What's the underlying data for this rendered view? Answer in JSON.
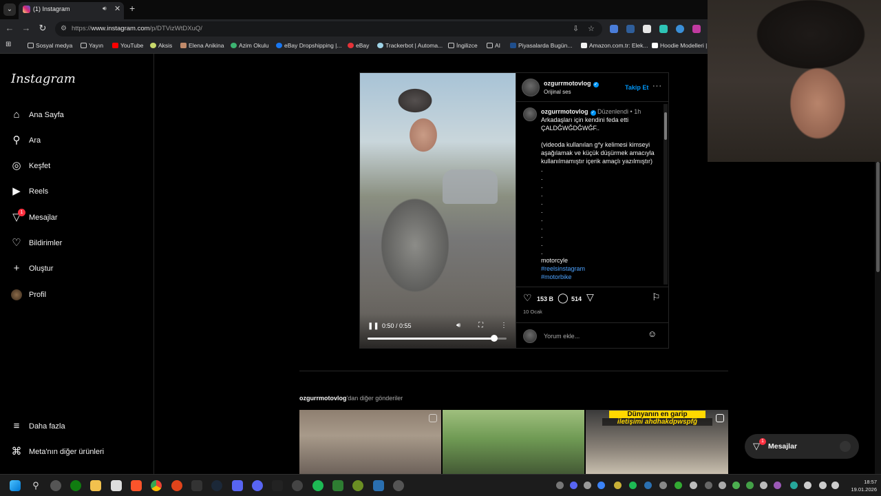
{
  "browser": {
    "tab_title": "(1) Instagram",
    "url_prefix": "https://",
    "url_domain": "www.instagram.com",
    "url_path": "/p/DTVizWtDXuQ/",
    "bookmarks": [
      "Sosyal medya",
      "Yayın",
      "YouTube",
      "Aksis",
      "Elena Anikina",
      "Azim Okulu",
      "eBay Dropshipping |...",
      "eBay",
      "Trackerbot | Automa...",
      "İngilizce",
      "AI",
      "Piyasalarda Bugün...",
      "Amazon.com.tr: Elek...",
      "Hoodie Modelleri |"
    ]
  },
  "sidebar": {
    "logo": "Instagram",
    "items": [
      {
        "label": "Ana Sayfa",
        "icon": "home-icon"
      },
      {
        "label": "Ara",
        "icon": "search-icon"
      },
      {
        "label": "Keşfet",
        "icon": "compass-icon"
      },
      {
        "label": "Reels",
        "icon": "reels-icon"
      },
      {
        "label": "Mesajlar",
        "icon": "messenger-icon",
        "badge": "1"
      },
      {
        "label": "Bildirimler",
        "icon": "heart-icon"
      },
      {
        "label": "Oluştur",
        "icon": "plus-icon"
      },
      {
        "label": "Profil",
        "icon": "avatar"
      }
    ],
    "more": "Daha fazla",
    "meta": "Meta'nın diğer ürünleri"
  },
  "post": {
    "username": "ozgurrmotovlog",
    "audio": "Orijinal ses",
    "follow": "Takip Et",
    "edited": "Düzenlendi",
    "time": "1h",
    "caption_lines": [
      "Arkadaşları için kendini feda etti",
      "ÇALDĞWĞDĞWĞF..",
      "",
      "(videoda kullanılan g*y kelimesi kimseyi aşağılamak ve küçük düşürmek amacıyla kullanılmamıştır içerik amaçlı yazılmıştır)"
    ],
    "dots": [
      ".",
      ".",
      ".",
      ".",
      ".",
      ".",
      ".",
      ".",
      ".",
      ".",
      "."
    ],
    "word": "motorcyle",
    "tags": [
      "#reelsinstagram",
      "#motorbike"
    ],
    "likes": "153 B",
    "comments": "514",
    "date": "10 Ocak",
    "comment_placeholder": "Yorum ekle...",
    "video_time": "0:50 / 0:55",
    "progress": 0.909
  },
  "more_posts": {
    "user": "ozgurrmotovlog",
    "suffix": "'dan diğer gönderiler",
    "third_title_1": "Dünyanın en garip",
    "third_title_2": "iletişimi ahdhakdpwspfğ"
  },
  "messages_pill": {
    "label": "Mesajlar",
    "badge": "1"
  },
  "taskbar": {
    "time": "18:57",
    "date": "19.01.2026"
  }
}
